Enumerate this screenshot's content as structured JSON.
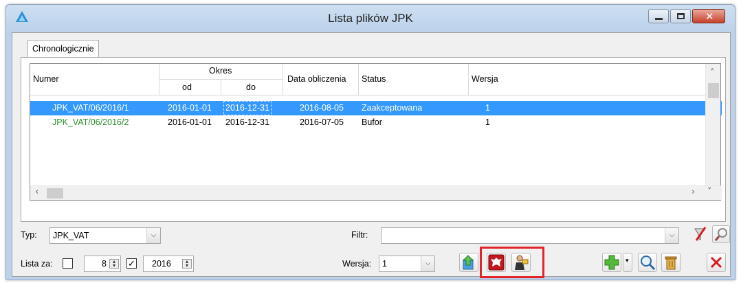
{
  "window": {
    "title": "Lista plików JPK"
  },
  "tabs": [
    "Chronologicznie"
  ],
  "grid": {
    "headers": {
      "numer": "Numer",
      "okres": "Okres",
      "od": "od",
      "do": "do",
      "data_obliczenia": "Data obliczenia",
      "status": "Status",
      "wersja": "Wersja"
    },
    "rows": [
      {
        "numer": "JPK_VAT/06/2016/1",
        "od": "2016-01-01",
        "do": "2016-12-31",
        "data": "2016-08-05",
        "status": "Zaakceptowana",
        "wersja": "1",
        "selected": true
      },
      {
        "numer": "JPK_VAT/06/2016/2",
        "od": "2016-01-01",
        "do": "2016-12-31",
        "data": "2016-07-05",
        "status": "Bufor",
        "wersja": "1",
        "selected": false
      }
    ]
  },
  "filters": {
    "typ_label": "Typ:",
    "typ_value": "JPK_VAT",
    "filtr_label": "Filtr:",
    "filtr_value": "",
    "lista_za_label": "Lista za:",
    "month_value": "8",
    "year_value": "2016",
    "wersja_label": "Wersja:",
    "wersja_value": "1"
  },
  "colors": {
    "selection": "#3399ff",
    "green_text": "#2a8f2a",
    "highlight_border": "#e3242b"
  },
  "icons": [
    "app-logo-icon",
    "minimize-icon",
    "maximize-icon",
    "close-icon",
    "clear-filter-icon",
    "filter-wizard-icon",
    "export-icon",
    "eagle-emblem-icon",
    "official-send-icon",
    "add-icon",
    "search-icon",
    "trash-icon",
    "close-x-icon"
  ]
}
